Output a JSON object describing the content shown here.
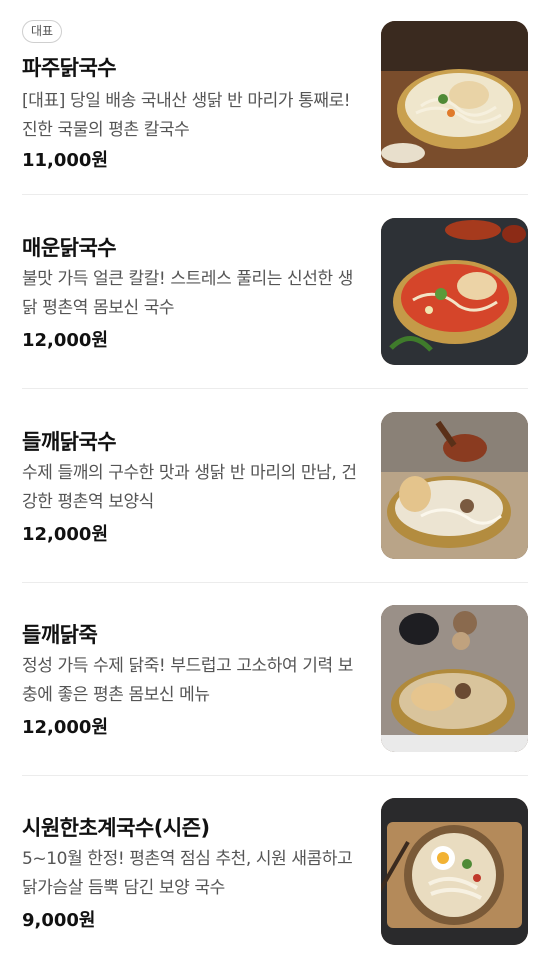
{
  "badge_label": "대표",
  "items": [
    {
      "name": "파주닭국수",
      "description": "[대표] 당일 배송 국내산 생닭 반 마리가 통째로! 진한 국물의 평촌 칼국수",
      "price": "11,000원",
      "image_icon": "chicken-noodle-soup-photo"
    },
    {
      "name": "매운닭국수",
      "description": "불맛 가득 얼큰 칼칼! 스트레스 풀리는 신선한 생닭 평촌역 몸보신 국수",
      "price": "12,000원",
      "image_icon": "spicy-chicken-noodle-photo"
    },
    {
      "name": "들깨닭국수",
      "description": "수제 들깨의 구수한 맛과 생닭 반 마리의 만남, 건강한 평촌역 보양식",
      "price": "12,000원",
      "image_icon": "perilla-chicken-noodle-photo"
    },
    {
      "name": "들깨닭죽",
      "description": "정성 가득 수제 닭죽! 부드럽고 고소하여 기력 보충에 좋은 평촌 몸보신 메뉴",
      "price": "12,000원",
      "image_icon": "perilla-chicken-porridge-photo"
    },
    {
      "name": "시원한초계국수(시즌)",
      "description": "5~10월 한정! 평촌역 점심 추천, 시원 새콤하고 닭가슴살 듬뿍 담긴 보양 국수",
      "price": "9,000원",
      "image_icon": "cold-chogye-noodle-photo"
    }
  ]
}
